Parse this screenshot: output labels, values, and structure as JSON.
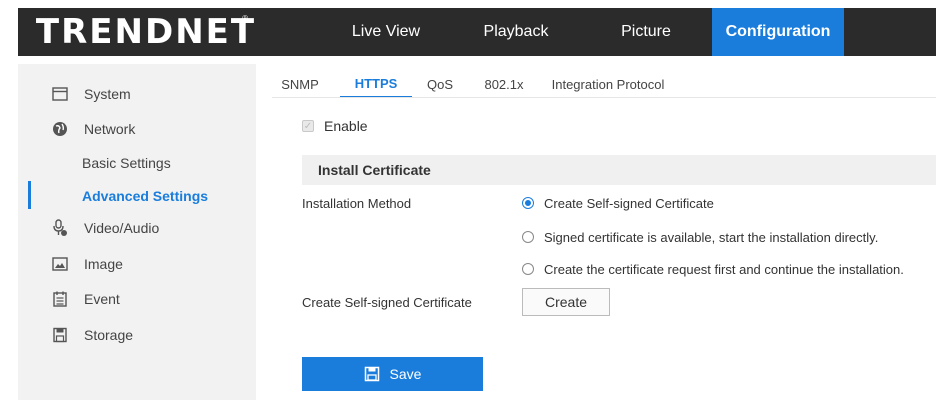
{
  "header": {
    "logo": "TRENDNET",
    "logo_reg": "®",
    "tabs": [
      {
        "label": "Live View"
      },
      {
        "label": "Playback"
      },
      {
        "label": "Picture"
      },
      {
        "label": "Configuration",
        "active": true
      }
    ]
  },
  "sidebar": {
    "items": [
      {
        "label": "System",
        "icon": "monitor-icon"
      },
      {
        "label": "Network",
        "icon": "globe-icon"
      },
      {
        "label": "Basic Settings",
        "sub": true
      },
      {
        "label": "Advanced Settings",
        "sub": true,
        "active": true
      },
      {
        "label": "Video/Audio",
        "icon": "video-audio-icon"
      },
      {
        "label": "Image",
        "icon": "image-icon"
      },
      {
        "label": "Event",
        "icon": "calendar-icon"
      },
      {
        "label": "Storage",
        "icon": "storage-icon"
      }
    ]
  },
  "subtabs": [
    {
      "label": "SNMP"
    },
    {
      "label": "HTTPS",
      "active": true
    },
    {
      "label": "QoS"
    },
    {
      "label": "802.1x"
    },
    {
      "label": "Integration Protocol"
    }
  ],
  "main": {
    "enable_label": "Enable",
    "enable_checked": true,
    "section_title": "Install Certificate",
    "installation_method_label": "Installation Method",
    "options": [
      {
        "label": "Create Self-signed Certificate",
        "checked": true
      },
      {
        "label": "Signed certificate is available, start the installation directly.",
        "checked": false
      },
      {
        "label": "Create the certificate request first and continue the installation.",
        "checked": false
      }
    ],
    "self_signed_label": "Create Self-signed Certificate",
    "create_button": "Create",
    "save_button": "Save"
  },
  "colors": {
    "accent": "#1a7ddc",
    "header_bg": "#2b2b2b",
    "sidebar_bg": "#f2f2f2"
  }
}
